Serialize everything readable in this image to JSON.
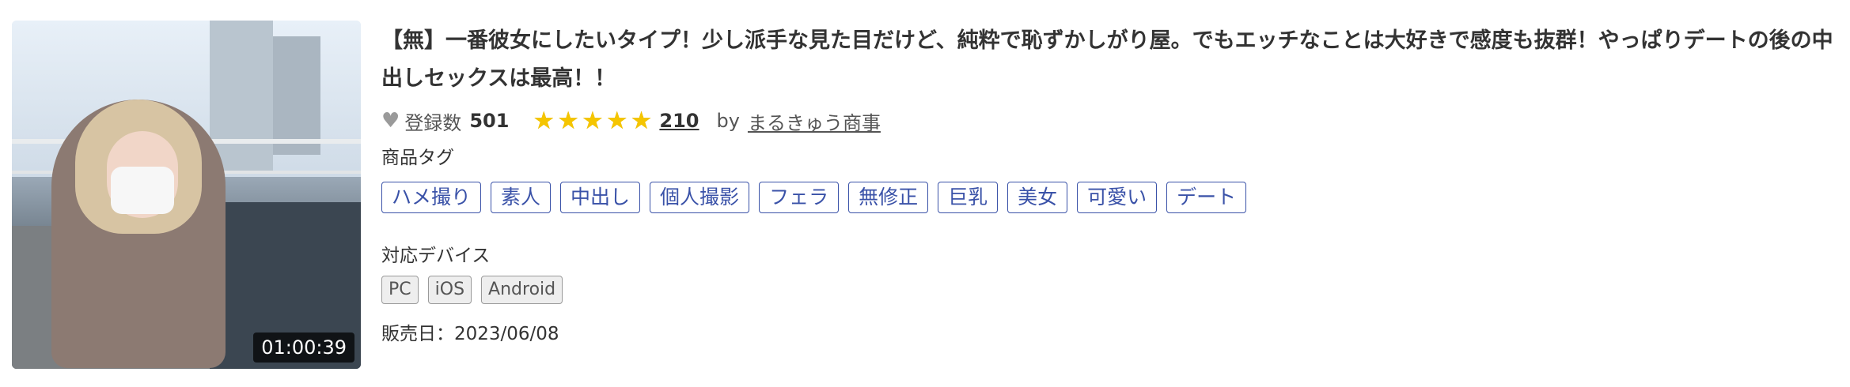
{
  "product": {
    "duration": "01:00:39",
    "title": "【無】一番彼女にしたいタイプ！少し派手な見た目だけど、純粋で恥ずかしがり屋。でもエッチなことは大好きで感度も抜群！やっぱりデートの後の中出しセックスは最高！！",
    "favorites": {
      "icon": "heart-icon",
      "label": "登録数",
      "count": "501"
    },
    "rating": {
      "stars": 5,
      "star_color": "#f5c500",
      "review_count": "210"
    },
    "by_label": "by",
    "seller": "まるきゅう商事",
    "tags_label": "商品タグ",
    "tags": [
      "ハメ撮り",
      "素人",
      "中出し",
      "個人撮影",
      "フェラ",
      "無修正",
      "巨乳",
      "美女",
      "可愛い",
      "デート"
    ],
    "tag_color": "#3a52a8",
    "devices_label": "対応デバイス",
    "devices": [
      "PC",
      "iOS",
      "Android"
    ],
    "release_text": "販売日：2023/06/08"
  }
}
